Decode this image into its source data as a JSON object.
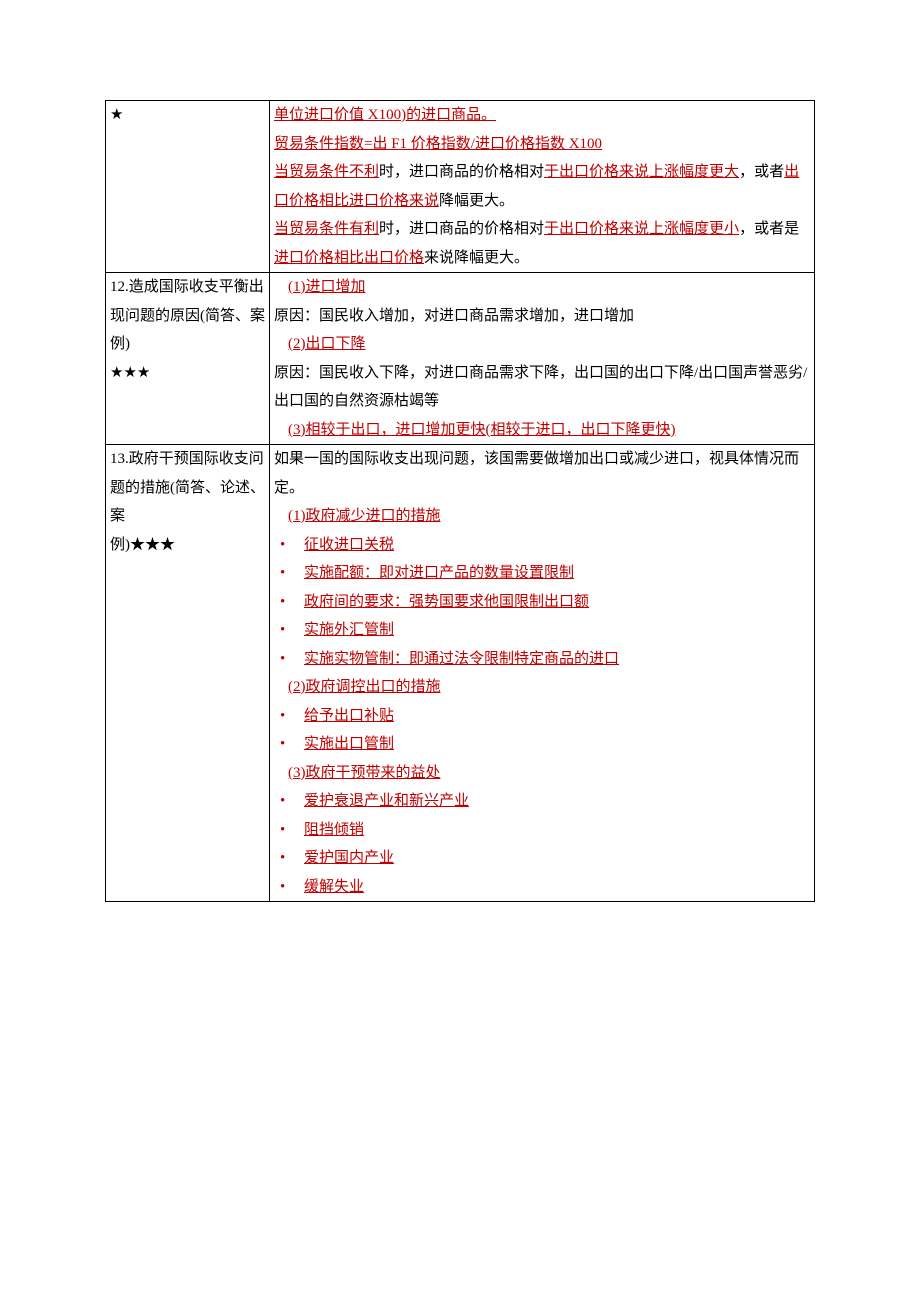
{
  "row11": {
    "left_star": "★",
    "line1a": "单位进口价值 X100)的进口商品。",
    "line2a": "贸易条件指数=出 F1 价格指数/进口价格指数 X100",
    "line3_a": "当",
    "line3_b": "贸易条件不利",
    "line3_c": "时，进口商品的价格相对",
    "line3_d": "于出口价格来说上涨幅度更大",
    "line3_e": "，或者",
    "line3_f": "出口价格相比进口价格来说",
    "line3_g": "降幅更大。",
    "line4_a": "当",
    "line4_b": "贸易条件有利",
    "line4_c": "时，进口商品的价格相对",
    "line4_d": "于出口价格来说上涨幅度更小",
    "line4_e": "，或者是",
    "line4_f": "进口价格相比出口价格",
    "line4_g": "来说降幅更大。"
  },
  "row12": {
    "left_1": "12.造成国际收支平衡出现问题的原因(简答、案例)",
    "left_stars": "★★★",
    "h1": "(1)进口增加",
    "p1": "原因：国民收入增加，对进口商品需求增加，进口增加",
    "h2": "(2)出口下降",
    "p2": "原因：国民收入下降，对进口商品需求下降，出口国的出口下降/出口国声誉恶劣/出口国的自然资源枯竭等",
    "h3": "(3)相较于出口，进口增加更快(相较于进口，出口下降更快)"
  },
  "row13": {
    "left_1": "13.政府干预国际收支问题的措施(简答、论述、案",
    "left_2": "例)",
    "left_stars": "★★★",
    "intro": "如果一国的国际收支出现问题，该国需要做增加出口或减少进口，视具体情况而定。",
    "h1": "(1)政府减少进口的措施",
    "b1": "征收进口关税",
    "b2": "实施配额：即对进口产品的数量设置限制",
    "b3": "政府间的要求：强势国要求他国限制出口额",
    "b4": "实施外汇管制",
    "b5": "实施实物管制：即通过法令限制特定商品的进口",
    "h2": "(2)政府调控出口的措施",
    "b6": "给予出口补贴",
    "b7": "实施出口管制",
    "h3": "(3)政府干预带来的益处",
    "b8": "爱护衰退产业和新兴产业",
    "b9": "阻挡倾销",
    "b10": "爱护国内产业",
    "b11": "缓解失业"
  }
}
